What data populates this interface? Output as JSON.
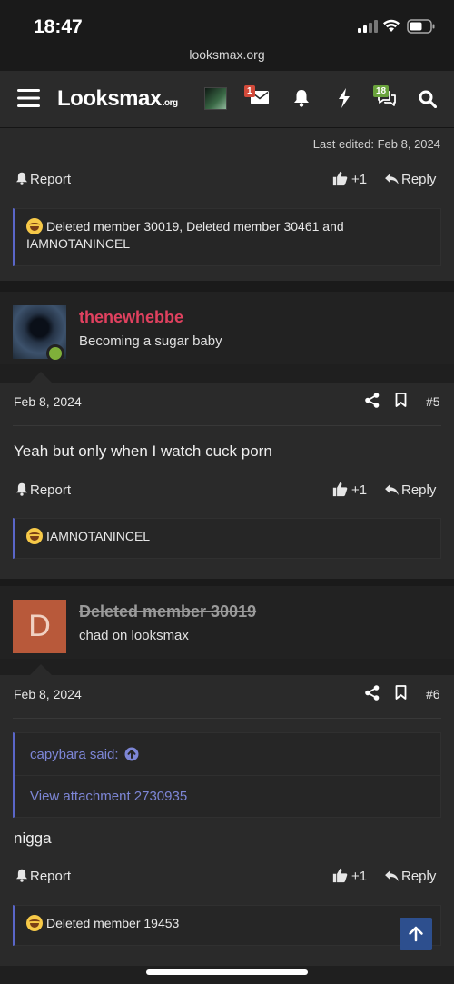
{
  "status_bar": {
    "time": "18:47",
    "url": "looksmax.org"
  },
  "nav": {
    "logo_main": "Looksmax",
    "logo_suffix": ".org",
    "inbox_badge": "1",
    "alerts_badge": "18"
  },
  "first_post_tail": {
    "last_edited": "Last edited: Feb 8, 2024",
    "report_label": "Report",
    "like_count": "+1",
    "reply_label": "Reply",
    "reactions": "Deleted member 30019, Deleted member 30461 and IAMNOTANINCEL"
  },
  "post5": {
    "username": "thenewhebbe",
    "user_title": "Becoming a sugar baby",
    "date": "Feb 8, 2024",
    "number": "#5",
    "text": "Yeah but only when I watch cuck porn",
    "report_label": "Report",
    "like_count": "+1",
    "reply_label": "Reply",
    "reactions": "IAMNOTANINCEL"
  },
  "post6": {
    "avatar_letter": "D",
    "username": "Deleted member 30019",
    "user_title": "chad on looksmax",
    "date": "Feb 8, 2024",
    "number": "#6",
    "quote_author": "capybara said:",
    "quote_link": "View attachment 2730935",
    "text": "nigga",
    "report_label": "Report",
    "like_count": "+1",
    "reply_label": "Reply",
    "reactions": "Deleted member 19453"
  },
  "colors": {
    "accent": "#5a66c8",
    "username_highlight": "#e0415f",
    "online": "#7fb03a",
    "deleted_avatar": "#b8593a"
  }
}
